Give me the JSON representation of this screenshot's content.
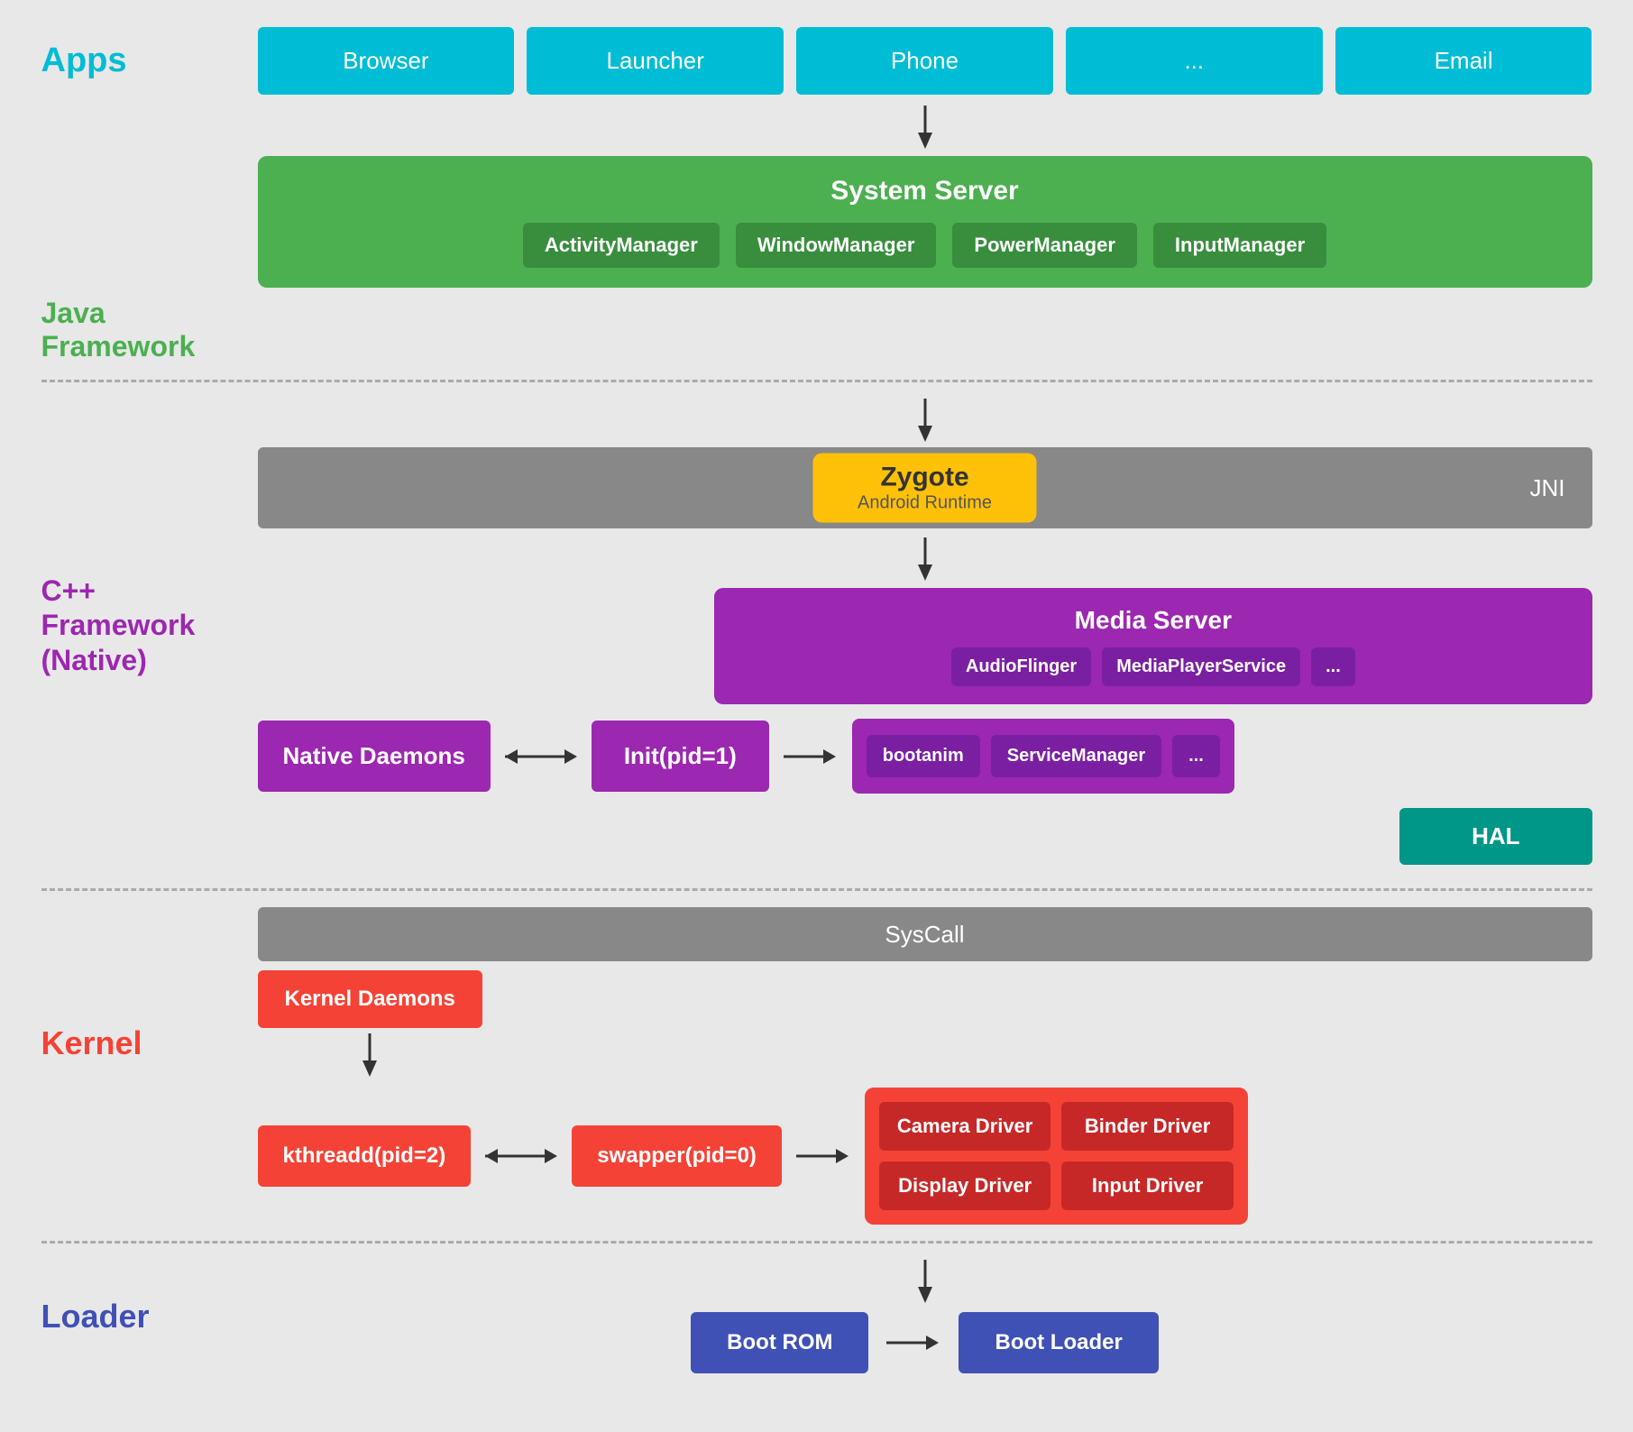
{
  "layers": {
    "apps": {
      "label": "Apps",
      "items": [
        "Browser",
        "Launcher",
        "Phone",
        "...",
        "Email"
      ]
    },
    "java_framework": {
      "label": "Java Framework",
      "system_server": {
        "title": "System Server",
        "items": [
          "ActivityManager",
          "WindowManager",
          "PowerManager",
          "InputManager"
        ]
      },
      "jni_label": "JNI"
    },
    "zygote": {
      "title": "Zygote",
      "subtitle": "Android Runtime"
    },
    "cpp_framework": {
      "label": "C++ Framework\n(Native)",
      "label_line1": "C++ Framework",
      "label_line2": "(Native)",
      "media_server": {
        "title": "Media Server",
        "items": [
          "AudioFlinger",
          "MediaPlayerService",
          "..."
        ]
      },
      "native_daemons": "Native Daemons",
      "init": "Init(pid=1)",
      "init_items": [
        "bootanim",
        "ServiceManager",
        "..."
      ],
      "hal": "HAL"
    },
    "syscall_label": "SysCall",
    "kernel": {
      "label": "Kernel",
      "kernel_daemons": "Kernel Daemons",
      "kthreadd": "kthreadd(pid=2)",
      "swapper": "swapper(pid=0)",
      "drivers": [
        "Camera Driver",
        "Binder Driver",
        "Display Driver",
        "Input Driver"
      ]
    },
    "loader": {
      "label": "Loader",
      "boot_rom": "Boot ROM",
      "boot_loader": "Boot Loader"
    }
  },
  "colors": {
    "apps_bg": "#00bcd4",
    "green": "#4caf50",
    "green_dark": "#388e3c",
    "yellow": "#ffc107",
    "purple": "#9c27b0",
    "purple_dark": "#7b1fa2",
    "teal": "#009688",
    "red": "#f44336",
    "red_dark": "#c62828",
    "blue": "#3f51b5",
    "gray": "#888888"
  }
}
